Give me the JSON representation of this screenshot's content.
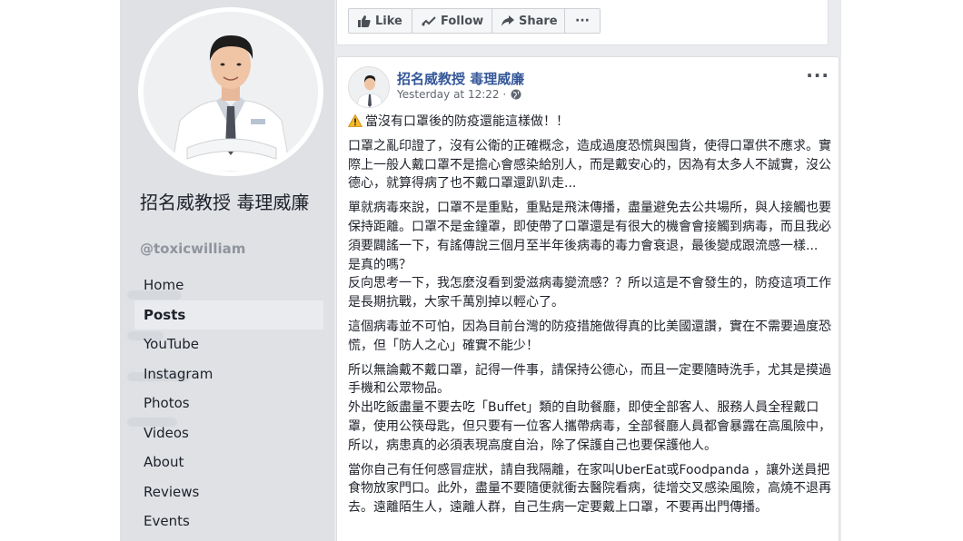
{
  "sidebar": {
    "page_name": "招名威教授 毒理威廉",
    "handle": "@toxicwilliam",
    "nav": [
      "Home",
      "Posts",
      "YouTube",
      "Instagram",
      "Photos",
      "Videos",
      "About",
      "Reviews",
      "Events"
    ],
    "active_nav": "Posts"
  },
  "actions": {
    "like": "Like",
    "follow": "Follow",
    "share": "Share",
    "more": "···"
  },
  "post": {
    "author": "招名威教授 毒理威廉",
    "time": "Yesterday at 12:22 ·",
    "more": "···",
    "paragraphs": [
      "當沒有口罩後的防疫還能這樣做！！",
      "口罩之亂印證了，沒有公衛的正確概念，造成過度恐慌與囤貨，使得口罩供不應求。實際上一般人戴口罩不是擔心會感染給別人，而是戴安心的，因為有太多人不誠實，沒公德心，就算得病了也不戴口罩還趴趴走...",
      "單就病毒來說，口罩不是重點，重點是飛沫傳播，盡量避免去公共場所，與人接觸也要保持距離。口罩不是金鐘罩，即使帶了口罩還是有很大的機會會接觸到病毒，而且我必須要闢謠一下，有謠傳說三個月至半年後病毒的毒力會衰退，最後變成跟流感一樣... 是真的嗎？\n反向思考一下，我怎麼沒看到愛滋病毒變流感？？所以這是不會發生的，防疫這項工作是長期抗戰，大家千萬別掉以輕心了。",
      "這個病毒並不可怕，因為目前台灣的防疫措施做得真的比美國還讚，實在不需要過度恐慌，但「防人之心」確實不能少！",
      "所以無論戴不戴口罩，記得一件事，請保持公德心，而且一定要隨時洗手，尤其是摸過手機和公眾物品。\n外出吃飯盡量不要去吃「Buffet」類的自助餐廳，即使全部客人、服務人員全程戴口罩，使用公筷母匙，但只要有一位客人攜帶病毒，全部餐廳人員都會暴露在高風險中，所以，病患真的必須表現高度自治，除了保護自己也要保護他人。",
      "當你自己有任何感冒症狀，請自我隔離，在家叫UberEat或Foodpanda ，讓外送員把食物放家門口。此外，盡量不要隨便就衝去醫院看病，徒增交叉感染風險，高燒不退再去。遠離陌生人，遠離人群，自己生病一定要戴上口罩，不要再出門傳播。"
    ]
  },
  "colors": {
    "link": "#365899",
    "text": "#1d2129",
    "sidebar_bg": "#dfe1e5",
    "page_bg": "#e9ebee"
  }
}
